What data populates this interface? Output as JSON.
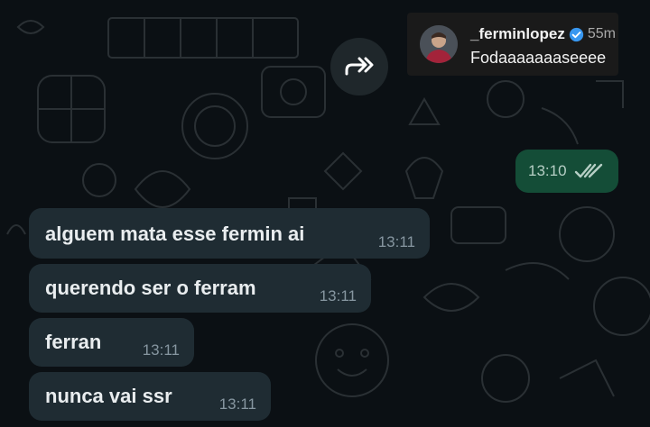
{
  "story_reply": {
    "username": "_ferminlopez",
    "age": "55m",
    "text": "Fodaaaaaaaseeee"
  },
  "messages_out": [
    {
      "time": "13:10",
      "status": "read"
    }
  ],
  "messages_in": [
    {
      "text": "alguem mata esse fermin ai",
      "time": "13:11"
    },
    {
      "text": "querendo ser o ferram",
      "time": "13:11"
    },
    {
      "text": "ferran",
      "time": "13:11"
    },
    {
      "text": "nunca vai ssr",
      "time": "13:11"
    }
  ],
  "icons": {
    "forward": "forward-icon",
    "verified": "verified-badge-icon",
    "read_receipt": "double-check-icon"
  },
  "colors": {
    "background": "#0b1014",
    "incoming_bubble": "#1f2c33",
    "outgoing_bubble": "#144d37",
    "verified_blue": "#3897f0",
    "read_tick": "#b6cfc5"
  }
}
